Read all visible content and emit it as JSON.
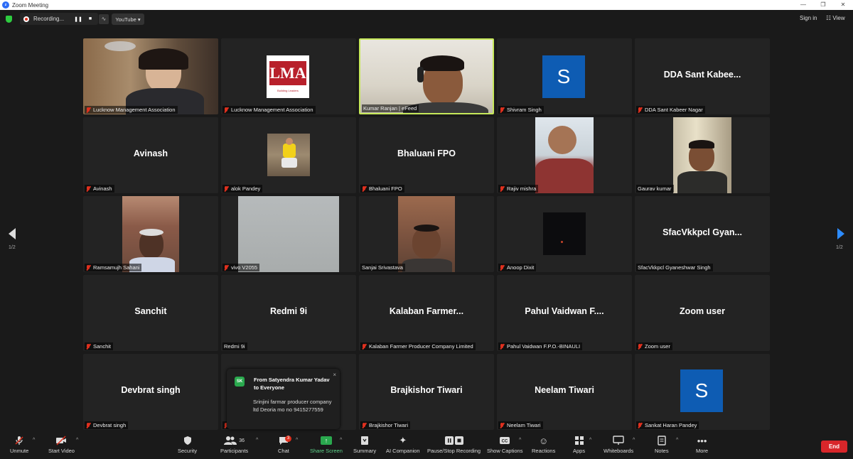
{
  "window": {
    "title": "Zoom Meeting",
    "controls": [
      "—",
      "❐",
      "✕"
    ]
  },
  "topbar": {
    "recording_label": "Recording...",
    "pause_glyph": "❚❚",
    "stop_glyph": "■",
    "stream_glyph": "∿",
    "youtube_label": "YouTube ▾",
    "sign_in": "Sign in",
    "view": "☷ View"
  },
  "pager": {
    "left": "1/2",
    "right": "1/2"
  },
  "tiles": [
    {
      "name": "Lucknow Management Association"
    },
    {
      "name": "Lucknow Management Association",
      "logo_text": "LMA",
      "logo_sub": "Building Leaders"
    },
    {
      "name": "Kumar Ranjan | eFeed",
      "active": true
    },
    {
      "name": "Shivram Singh",
      "initial": "S"
    },
    {
      "big": "DDA Sant Kabee...",
      "name": "DDA Sant Kabeer Nagar"
    },
    {
      "big": "Avinash",
      "name": "Avinash"
    },
    {
      "name": "alok Pandey"
    },
    {
      "big": "Bhaluani FPO",
      "name": "Bhaluani FPO"
    },
    {
      "name": "Rajiv mishra"
    },
    {
      "name": "Gaurav kumar"
    },
    {
      "name": "Ramsamujh Sahani"
    },
    {
      "name": "vivo V2055"
    },
    {
      "name": "Sanjai Srivastava"
    },
    {
      "name": "Anoop Dixit"
    },
    {
      "big": "SfacVkkpcl  Gyan...",
      "name": "SfacVkkpcl Gyaneshwar Singh"
    },
    {
      "big": "Sanchit",
      "name": "Sanchit"
    },
    {
      "big": "Redmi 9i",
      "name": "Redmi 9i"
    },
    {
      "big": "Kalaban  Farmer...",
      "name": "Kalaban Farmer Producer Company Limited"
    },
    {
      "big": "Pahul  Vaidwan  F....",
      "name": "Pahul Vaidwan F.P.O.-BINAULI"
    },
    {
      "big": "Zoom user",
      "name": "Zoom user"
    },
    {
      "big": "Devbrat singh",
      "name": "Devbrat singh"
    },
    {
      "name": ""
    },
    {
      "big": "Brajkishor Tiwari",
      "name": "Brajkishor Tiwari"
    },
    {
      "big": "Neelam Tiwari",
      "name": "Neelam Tiwari"
    },
    {
      "name": "Sankat Haran Pandey",
      "initial": "S"
    }
  ],
  "chat_popup": {
    "initials": "SK",
    "from": "From Satyendra Kumar Yadav to Everyone",
    "message": "Srinjini farmar producer company ltd Deoria mo no 9415277559",
    "close": "×"
  },
  "toolbar": {
    "unmute": "Unmute",
    "start_video": "Start Video",
    "security": "Security",
    "participants": "Participants",
    "participants_count": "36",
    "chat": "Chat",
    "chat_badge": "3",
    "share_screen": "Share Screen",
    "summary": "Summary",
    "ai_companion": "AI Companion",
    "pause_stop_recording": "Pause/Stop Recording",
    "show_captions": "Show Captions",
    "reactions": "Reactions",
    "apps": "Apps",
    "whiteboards": "Whiteboards",
    "notes": "Notes",
    "more": "More",
    "end": "End"
  }
}
